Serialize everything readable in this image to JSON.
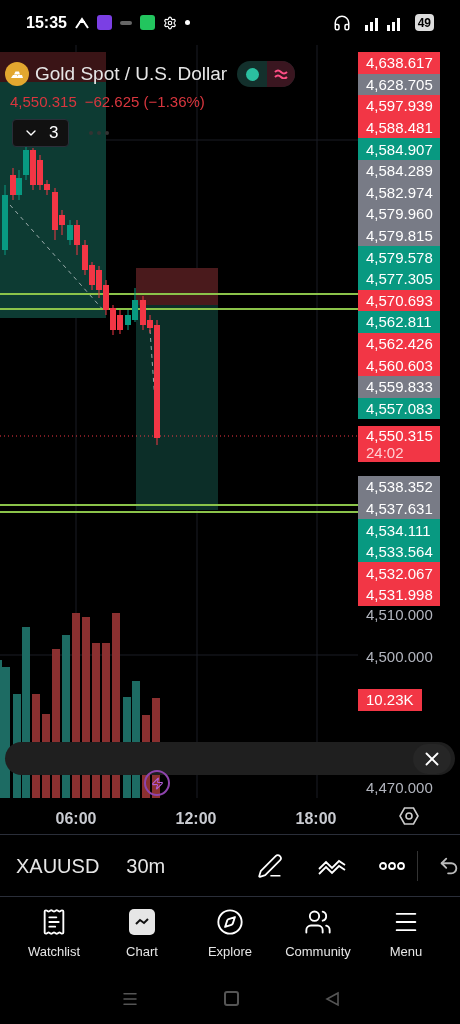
{
  "status_bar": {
    "time": "15:35",
    "battery": "49"
  },
  "symbol": {
    "title": "Gold Spot / U.S. Dollar",
    "price": "4,550.315",
    "change": "−62.625 (−1.36%)",
    "indicator_count": "3",
    "live": true
  },
  "price_labels": [
    {
      "text": "4,638.617",
      "color": "#f23645"
    },
    {
      "text": "4,628.705",
      "color": "#787b86"
    },
    {
      "text": "4,597.939",
      "color": "#f23645"
    },
    {
      "text": "4,588.481",
      "color": "#f23645"
    },
    {
      "text": "4,584.907",
      "color": "#089981"
    },
    {
      "text": "4,584.289",
      "color": "#787b86"
    },
    {
      "text": "4,582.974",
      "color": "#787b86"
    },
    {
      "text": "4,579.960",
      "color": "#787b86"
    },
    {
      "text": "4,579.815",
      "color": "#787b86"
    },
    {
      "text": "4,579.578",
      "color": "#089981"
    },
    {
      "text": "4,577.305",
      "color": "#089981"
    },
    {
      "text": "4,570.693",
      "color": "#f23645"
    },
    {
      "text": "4,562.811",
      "color": "#089981"
    },
    {
      "text": "4,562.426",
      "color": "#f23645"
    },
    {
      "text": "4,560.603",
      "color": "#f23645"
    },
    {
      "text": "4,559.833",
      "color": "#787b86"
    },
    {
      "text": "4,557.083",
      "color": "#089981"
    }
  ],
  "current_price": {
    "price": "4,550.315",
    "countdown": "24:02"
  },
  "price_labels_lower": [
    {
      "text": "4,538.352",
      "color": "#787b86"
    },
    {
      "text": "4,537.631",
      "color": "#787b86"
    },
    {
      "text": "4,534.111",
      "color": "#089981"
    },
    {
      "text": "4,533.564",
      "color": "#089981"
    },
    {
      "text": "4,532.067",
      "color": "#f23645"
    },
    {
      "text": "4,531.998",
      "color": "#f23645"
    }
  ],
  "axis_labels": [
    "4,510.000",
    "4,500.000",
    "4,470.000"
  ],
  "volume_label": "10.23K",
  "time_axis": [
    "06:00",
    "12:00",
    "18:00"
  ],
  "toolbar": {
    "symbol": "XAUUSD",
    "interval": "30m"
  },
  "nav": [
    {
      "label": "Watchlist",
      "selected": false
    },
    {
      "label": "Chart",
      "selected": true
    },
    {
      "label": "Explore",
      "selected": false
    },
    {
      "label": "Community",
      "selected": false
    },
    {
      "label": "Menu",
      "selected": false
    }
  ]
}
